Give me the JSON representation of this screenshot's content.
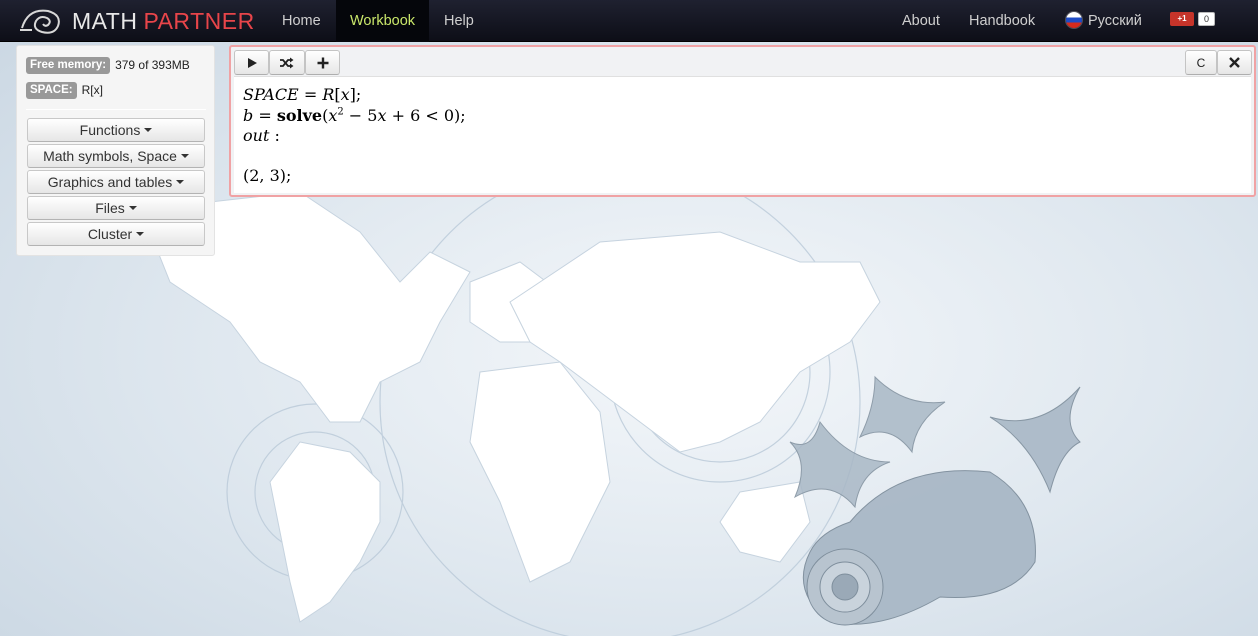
{
  "navbar": {
    "brand_math": "MATH",
    "brand_partner": "PARTNER",
    "items": [
      {
        "label": "Home"
      },
      {
        "label": "Workbook",
        "active": true
      },
      {
        "label": "Help"
      }
    ],
    "right_items": [
      {
        "label": "About"
      },
      {
        "label": "Handbook"
      },
      {
        "label": "Русский",
        "icon": "russia-flag-icon"
      }
    ],
    "gplus": {
      "label": "+1",
      "count": "0"
    }
  },
  "sidebar": {
    "free_memory_label": "Free memory:",
    "free_memory_value": "379 of 393MB",
    "space_label": "SPACE:",
    "space_value": "R[x]",
    "buttons": [
      {
        "label": "Functions"
      },
      {
        "label": "Math symbols, Space"
      },
      {
        "label": "Graphics and tables"
      },
      {
        "label": "Files"
      },
      {
        "label": "Cluster"
      }
    ]
  },
  "section": {
    "toolbar": {
      "run_icon": "play-icon",
      "random_icon": "shuffle-icon",
      "add_icon": "plus-icon",
      "clear_label": "C",
      "close_icon": "close-icon"
    },
    "lines": {
      "l1_space": "SPACE",
      "l1_eq": " = ",
      "l1_r": "R",
      "l1_x": "x",
      "l1_end": ";",
      "l2_b": "b",
      "l2_eq": " = ",
      "l2_solve": "solve",
      "l2_x": "x",
      "l2_exp": "2",
      "l2_rest1": " − 5",
      "l2_x2": "x",
      "l2_rest2": " + 6 < 0);",
      "l3_out": "out",
      "l3_colon": " :",
      "result": "(2, 3);"
    }
  },
  "colors": {
    "navbar_bg": "#0d0e17",
    "brand_red": "#e8454a",
    "active_green": "#c9e66a",
    "section_border": "#f0a2a4"
  }
}
